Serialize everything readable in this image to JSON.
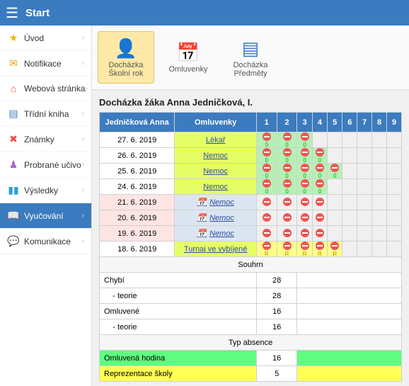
{
  "topbar": {
    "title": "Start"
  },
  "sidebar": {
    "items": [
      {
        "label": "Úvod",
        "icon": "★",
        "color": "#f0b400"
      },
      {
        "label": "Notifikace",
        "icon": "✉",
        "color": "#f0a000"
      },
      {
        "label": "Webová stránka",
        "icon": "⌂",
        "color": "#e94f4f"
      },
      {
        "label": "Třídní kniha",
        "icon": "▤",
        "color": "#3b7bbf"
      },
      {
        "label": "Známky",
        "icon": "✖",
        "color": "#e94f4f"
      },
      {
        "label": "Probrané učivo",
        "icon": "♟",
        "color": "#b05fd0"
      },
      {
        "label": "Výsledky",
        "icon": "▮▮",
        "color": "#2aa0d8"
      },
      {
        "label": "Vyučování",
        "icon": "📖",
        "color": "#fff"
      },
      {
        "label": "Komunikace",
        "icon": "💬",
        "color": "#e94f4f"
      }
    ]
  },
  "toolbar": {
    "btns": [
      {
        "label1": "Docházka",
        "label2": "Školní rok",
        "icon": "👤"
      },
      {
        "label1": "Omluvenky",
        "label2": "",
        "icon": "📅"
      },
      {
        "label1": "Docházka",
        "label2": "Předměty",
        "icon": "▤"
      }
    ]
  },
  "page": {
    "title": "Docházka žáka Anna Jedničková, I."
  },
  "table": {
    "head": {
      "name": "Jedničková Anna",
      "om": "Omluvenky",
      "hours": [
        "1",
        "2",
        "3",
        "4",
        "5",
        "6",
        "7",
        "8",
        "9"
      ]
    },
    "rows": [
      {
        "date": "27. 6. 2019",
        "om": "Lékař",
        "cells": [
          "g0",
          "g0",
          "g0",
          "",
          "",
          "",
          "",
          "",
          ""
        ]
      },
      {
        "date": "26. 6. 2019",
        "om": "Nemoc",
        "cells": [
          "g0",
          "g0",
          "g0",
          "g0",
          "",
          "",
          "",
          "",
          ""
        ]
      },
      {
        "date": "25. 6. 2019",
        "om": "Nemoc",
        "cells": [
          "g0",
          "g0",
          "g0",
          "g0",
          "g0",
          "",
          "",
          "",
          ""
        ]
      },
      {
        "date": "24. 6. 2019",
        "om": "Nemoc",
        "cells": [
          "g0",
          "g0",
          "g0",
          "g0",
          "",
          "",
          "",
          "",
          ""
        ]
      },
      {
        "date": "21. 6. 2019",
        "pink": true,
        "om": "Nemoc",
        "omBlue": true,
        "cells": [
          "d",
          "d",
          "d",
          "d",
          "",
          "",
          "",
          "",
          ""
        ]
      },
      {
        "date": "20. 6. 2019",
        "pink": true,
        "om": "Nemoc",
        "omBlue": true,
        "cells": [
          "d",
          "d",
          "d",
          "d",
          "",
          "",
          "",
          "",
          ""
        ]
      },
      {
        "date": "19. 6. 2019",
        "pink": true,
        "om": "Nemoc",
        "omBlue": true,
        "cells": [
          "d",
          "d",
          "d",
          "d",
          "",
          "",
          "",
          "",
          ""
        ]
      },
      {
        "date": "18. 6. 2019",
        "om": "Turnaj ve vybíjené",
        "cells": [
          "yR",
          "yR",
          "yR",
          "yR",
          "yR",
          "",
          "",
          "",
          ""
        ]
      }
    ]
  },
  "summary": {
    "header": "Souhrn",
    "rows": [
      {
        "label": "Chybí",
        "val": "28"
      },
      {
        "label": "    - teorie",
        "val": "28"
      },
      {
        "label": "Omluvené",
        "val": "16"
      },
      {
        "label": "    - teorie",
        "val": "16"
      }
    ],
    "typHeader": "Typ absence",
    "legend": [
      {
        "label": "Omluvená hodina",
        "val": "16",
        "cls": "legend-g"
      },
      {
        "label": "Reprezentace školy",
        "val": "5",
        "cls": "legend-y"
      }
    ]
  }
}
